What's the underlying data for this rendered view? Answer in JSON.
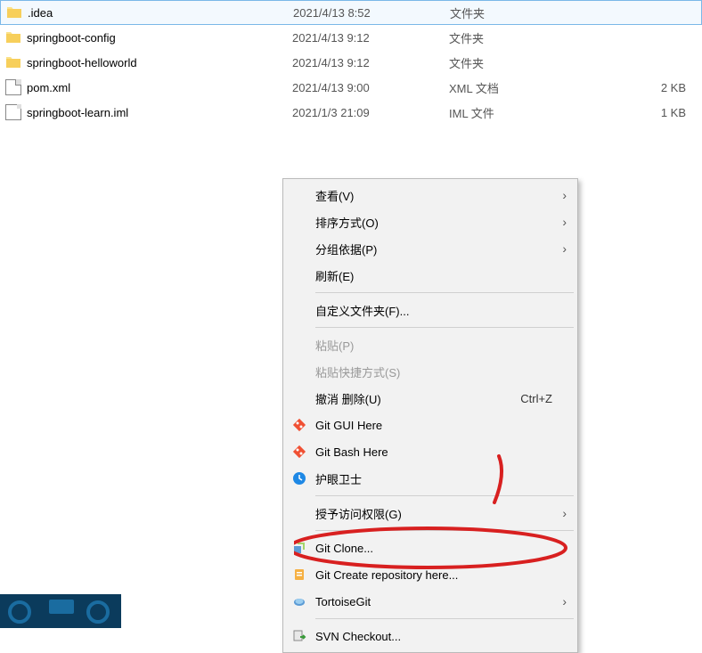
{
  "files": [
    {
      "name": ".idea",
      "date": "2021/4/13 8:52",
      "type": "文件夹",
      "size": "",
      "kind": "folder",
      "selected": true
    },
    {
      "name": "springboot-config",
      "date": "2021/4/13 9:12",
      "type": "文件夹",
      "size": "",
      "kind": "folder",
      "selected": false
    },
    {
      "name": "springboot-helloworld",
      "date": "2021/4/13 9:12",
      "type": "文件夹",
      "size": "",
      "kind": "folder",
      "selected": false
    },
    {
      "name": "pom.xml",
      "date": "2021/4/13 9:00",
      "type": "XML 文档",
      "size": "2 KB",
      "kind": "xml",
      "selected": false
    },
    {
      "name": "springboot-learn.iml",
      "date": "2021/1/3 21:09",
      "type": "IML 文件",
      "size": "1 KB",
      "kind": "iml",
      "selected": false
    }
  ],
  "menu": {
    "view": "查看(V)",
    "sort": "排序方式(O)",
    "group": "分组依据(P)",
    "refresh": "刷新(E)",
    "customize": "自定义文件夹(F)...",
    "paste": "粘贴(P)",
    "paste_shortcut": "粘贴快捷方式(S)",
    "undo_delete": "撤消 删除(U)",
    "undo_key": "Ctrl+Z",
    "git_gui": "Git GUI Here",
    "git_bash": "Git Bash Here",
    "eye_guard": "护眼卫士",
    "grant_access": "授予访问权限(G)",
    "git_clone": "Git Clone...",
    "git_create": "Git Create repository here...",
    "tortoisegit": "TortoiseGit",
    "svn_checkout": "SVN Checkout..."
  }
}
